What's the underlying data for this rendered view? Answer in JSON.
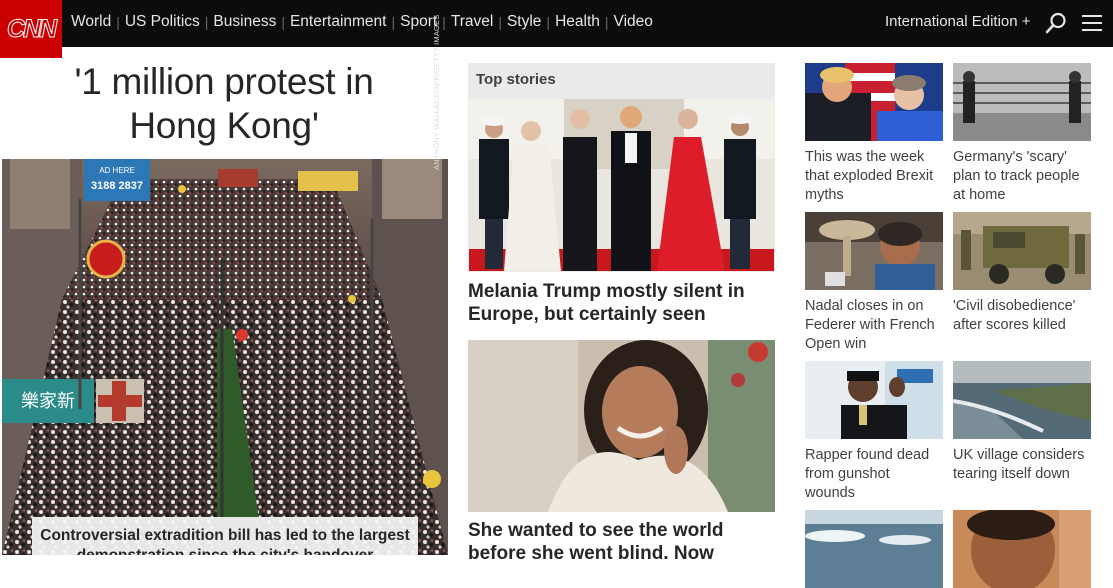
{
  "nav": {
    "logo": "CNN",
    "links": [
      "World",
      "US Politics",
      "Business",
      "Entertainment",
      "Sport",
      "Travel",
      "Style",
      "Health",
      "Video"
    ],
    "edition": "International Edition +",
    "search_icon": "search-icon",
    "menu_icon": "menu-icon"
  },
  "lead": {
    "headline_line1": "'1 million protest in",
    "headline_line2": "Hong Kong'",
    "photo_credit": "ANTHONY WALLACE/AFP/GETTY IMAGES",
    "sign_text": "AD HERE",
    "sign_phone": "3188 2837",
    "shop_sign": "樂家新",
    "caption": "Controversial extradition bill has led to the largest demonstration since the city's handover"
  },
  "top_stories": {
    "label": "Top stories",
    "story1_title": "Melania Trump mostly silent in Europe, but certainly seen",
    "story2_title": "She wanted to see the world before she went blind. Now"
  },
  "cards": [
    {
      "title": "This was the week that exploded Brexit myths"
    },
    {
      "title": "Germany's 'scary' plan to track people at home"
    },
    {
      "title": "Nadal closes in on Federer with French Open win"
    },
    {
      "title": "'Civil disobedience' after scores killed"
    },
    {
      "title": "Rapper found dead from gunshot wounds"
    },
    {
      "title": "UK village considers tearing itself down"
    }
  ],
  "colors": {
    "brand": "#cc0000",
    "nav_bg": "#0c0c0c",
    "top_stories_bg": "#eaeaea"
  }
}
